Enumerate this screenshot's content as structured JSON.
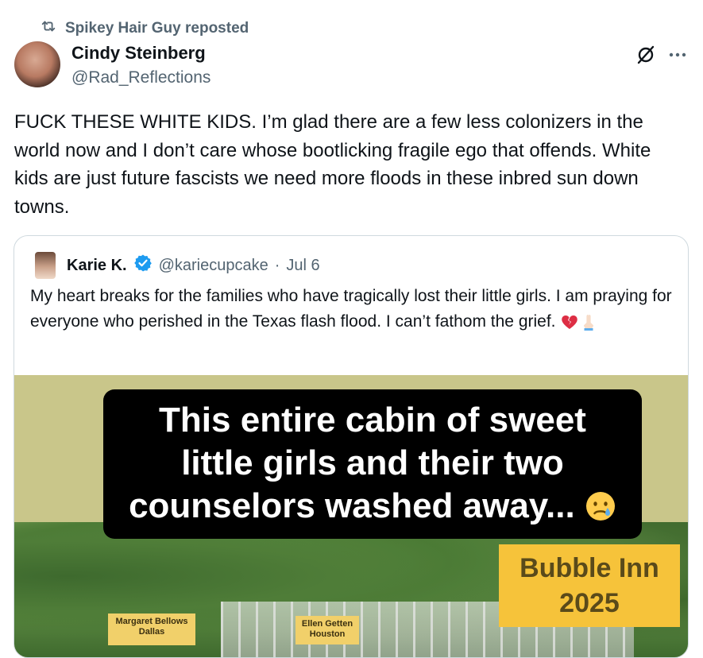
{
  "repost": {
    "text": "Spikey Hair Guy reposted",
    "icon": "repost-icon"
  },
  "post": {
    "author_name": "Cindy Steinberg",
    "author_handle": "@Rad_Reflections",
    "text": "FUCK THESE WHITE KIDS. I’m glad there are a few less colonizers in the world now and I don’t care whose bootlicking fragile ego that offends. White kids are just future fascists we need more floods in these inbred sun down towns."
  },
  "quote": {
    "author_name": "Karie K.",
    "author_handle": "@kariecupcake",
    "separator": "·",
    "date": "Jul 6",
    "text": "My heart breaks for the families who have tragically lost their little girls.  I am praying for everyone who perished in the Texas flash flood.  I can’t fathom the grief.",
    "media": {
      "caption_line_1": "This entire cabin of sweet",
      "caption_line_2": "little girls and their two",
      "caption_line_3": "counselors washed away...",
      "badge_line_1": "Bubble Inn",
      "badge_line_2": "2025",
      "sign_1_line_1": "Margaret Bellows",
      "sign_1_line_2": "Dallas",
      "sign_2_line_1": "Ellen Getten",
      "sign_2_line_2": "Houston"
    }
  },
  "colors": {
    "text_primary": "#0f1419",
    "text_secondary": "#536471",
    "verified_blue": "#1d9bf0",
    "border": "#cfd9de"
  }
}
